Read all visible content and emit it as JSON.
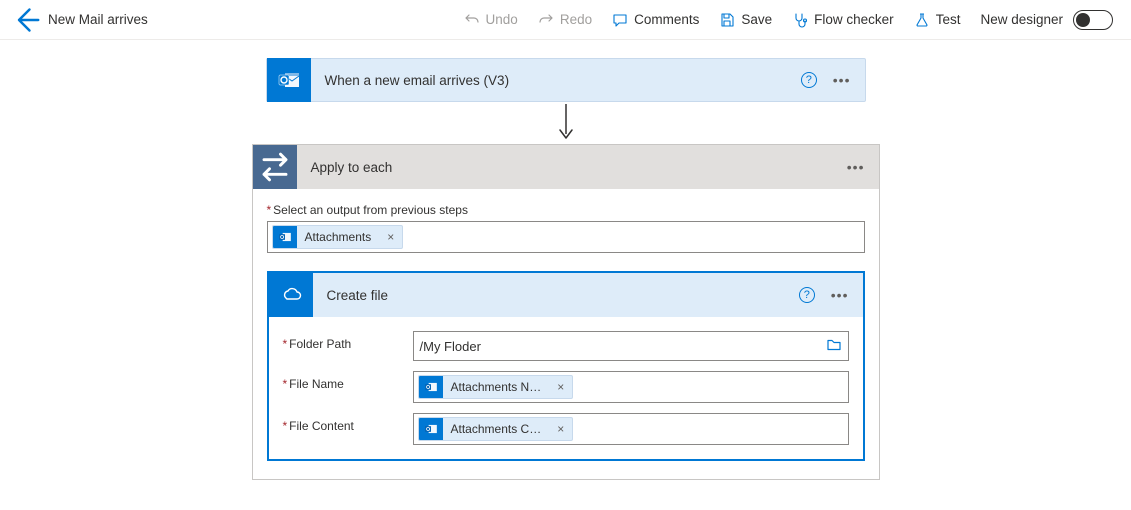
{
  "header": {
    "title": "New Mail arrives",
    "undo": "Undo",
    "redo": "Redo",
    "comments": "Comments",
    "save": "Save",
    "flowchecker": "Flow checker",
    "test": "Test",
    "newdesigner": "New designer"
  },
  "trigger": {
    "title": "When a new email arrives (V3)"
  },
  "apply": {
    "title": "Apply to each",
    "select_label": "Select an output from previous steps",
    "select_token": "Attachments",
    "create": {
      "title": "Create file",
      "folder_label": "Folder Path",
      "folder_value": "/My Floder",
      "filename_label": "File Name",
      "filename_token": "Attachments N…",
      "filecontent_label": "File Content",
      "filecontent_token": "Attachments C…"
    }
  }
}
